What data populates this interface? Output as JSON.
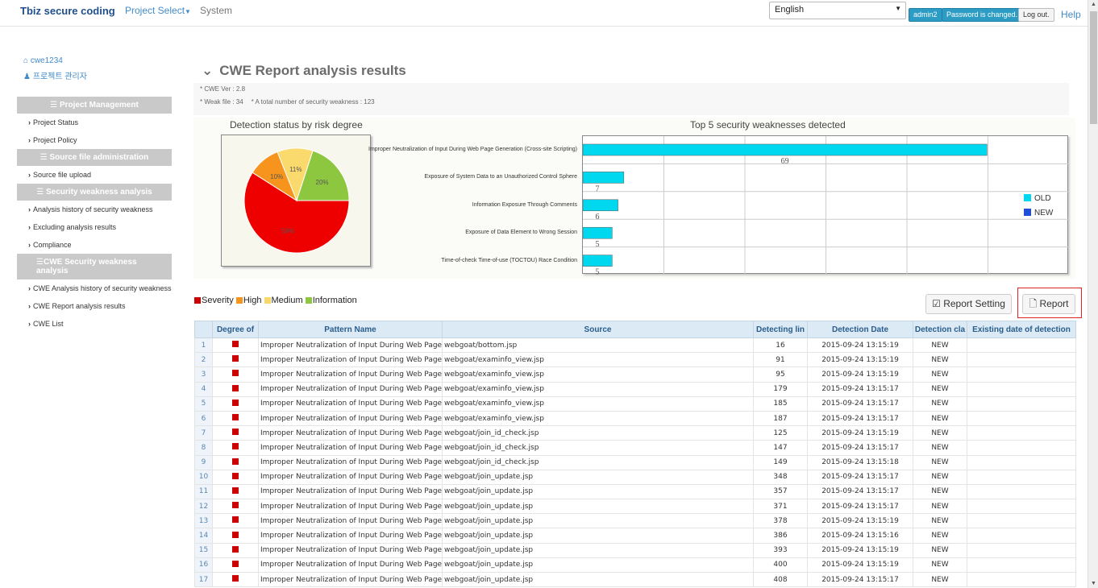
{
  "header": {
    "brand": "Tbiz secure coding",
    "project_select": "Project Select",
    "system": "System",
    "language": "English",
    "user_button": "admin2",
    "password_button": "Password is changed.",
    "logout_button": "Log out.",
    "help": "Help"
  },
  "sidebar": {
    "project_name": "cwe1234",
    "role": "프로젝트 관리자",
    "sections": [
      {
        "title": "Project Management",
        "items": [
          "Project Status",
          "Project Policy"
        ]
      },
      {
        "title": "Source file administration",
        "items": [
          "Source file upload"
        ]
      },
      {
        "title": "Security weakness analysis",
        "items": [
          "Analysis history of security weakness",
          "Excluding analysis results",
          "Compliance"
        ]
      },
      {
        "title": "CWE Security weakness analysis",
        "items": [
          "CWE Analysis history of security weakness",
          "CWE Report analysis results",
          "CWE List"
        ]
      }
    ]
  },
  "main": {
    "title": "CWE Report analysis results",
    "cwe_ver": "* CWE Ver : 2.8",
    "weak_file": "* Weak file : 34",
    "total": "* A total number of security weakness : 123",
    "legend": [
      "Severity",
      "High",
      "Medium",
      "Information"
    ],
    "legend_colors": [
      "#cc0000",
      "#f7941d",
      "#f9d86b",
      "#8dc63f"
    ],
    "report_setting": "Report Setting",
    "report": "Report"
  },
  "chart_data": [
    {
      "type": "pie",
      "title": "Detection status by risk degree",
      "labels": [
        "Severity",
        "High",
        "Medium",
        "Information"
      ],
      "values": [
        59,
        10,
        11,
        20
      ],
      "colors": [
        "#ee0000",
        "#f7941d",
        "#fad96d",
        "#8dc63f"
      ]
    },
    {
      "type": "bar",
      "title": "Top 5 security weaknesses detected",
      "categories": [
        "Improper Neutralization of Input During Web Page Generation (Cross-site Scripting)",
        "Exposure of System Data to an Unauthorized Control Sphere",
        "Information Exposure Through Comments",
        "Exposure of Data Element to Wrong Session",
        "Time-of-check Time-of-use (TOCTOU) Race Condition"
      ],
      "series": [
        {
          "name": "OLD",
          "values": [
            69,
            7,
            6,
            5,
            5
          ],
          "color": "#00d8f0"
        },
        {
          "name": "NEW",
          "values": [
            0,
            0,
            0,
            0,
            0
          ],
          "color": "#1f4fd8"
        }
      ],
      "xlim": [
        0,
        83
      ],
      "legend": "right"
    }
  ],
  "table": {
    "headers": [
      "",
      "Degree of",
      "Pattern Name",
      "Source",
      "Detecting lin",
      "Detection Date",
      "Detection cla",
      "Existing date of detection"
    ],
    "pattern": "Improper Neutralization of Input During Web Page Generation (Cross-site Scripting)",
    "rows": [
      {
        "n": "1",
        "src": "webgoat/bottom.jsp",
        "line": "16",
        "date": "2015-09-24 13:15:19",
        "cls": "NEW"
      },
      {
        "n": "2",
        "src": "webgoat/examinfo_view.jsp",
        "line": "91",
        "date": "2015-09-24 13:15:19",
        "cls": "NEW"
      },
      {
        "n": "3",
        "src": "webgoat/examinfo_view.jsp",
        "line": "95",
        "date": "2015-09-24 13:15:19",
        "cls": "NEW"
      },
      {
        "n": "4",
        "src": "webgoat/examinfo_view.jsp",
        "line": "179",
        "date": "2015-09-24 13:15:17",
        "cls": "NEW"
      },
      {
        "n": "5",
        "src": "webgoat/examinfo_view.jsp",
        "line": "185",
        "date": "2015-09-24 13:15:17",
        "cls": "NEW"
      },
      {
        "n": "6",
        "src": "webgoat/examinfo_view.jsp",
        "line": "187",
        "date": "2015-09-24 13:15:17",
        "cls": "NEW"
      },
      {
        "n": "7",
        "src": "webgoat/join_id_check.jsp",
        "line": "125",
        "date": "2015-09-24 13:15:19",
        "cls": "NEW"
      },
      {
        "n": "8",
        "src": "webgoat/join_id_check.jsp",
        "line": "147",
        "date": "2015-09-24 13:15:17",
        "cls": "NEW"
      },
      {
        "n": "9",
        "src": "webgoat/join_id_check.jsp",
        "line": "149",
        "date": "2015-09-24 13:15:18",
        "cls": "NEW"
      },
      {
        "n": "10",
        "src": "webgoat/join_update.jsp",
        "line": "348",
        "date": "2015-09-24 13:15:17",
        "cls": "NEW"
      },
      {
        "n": "11",
        "src": "webgoat/join_update.jsp",
        "line": "357",
        "date": "2015-09-24 13:15:17",
        "cls": "NEW"
      },
      {
        "n": "12",
        "src": "webgoat/join_update.jsp",
        "line": "371",
        "date": "2015-09-24 13:15:17",
        "cls": "NEW"
      },
      {
        "n": "13",
        "src": "webgoat/join_update.jsp",
        "line": "378",
        "date": "2015-09-24 13:15:19",
        "cls": "NEW"
      },
      {
        "n": "14",
        "src": "webgoat/join_update.jsp",
        "line": "386",
        "date": "2015-09-24 13:15:16",
        "cls": "NEW"
      },
      {
        "n": "15",
        "src": "webgoat/join_update.jsp",
        "line": "393",
        "date": "2015-09-24 13:15:19",
        "cls": "NEW"
      },
      {
        "n": "16",
        "src": "webgoat/join_update.jsp",
        "line": "400",
        "date": "2015-09-24 13:15:19",
        "cls": "NEW"
      },
      {
        "n": "17",
        "src": "webgoat/join_update.jsp",
        "line": "408",
        "date": "2015-09-24 13:15:17",
        "cls": "NEW"
      }
    ]
  }
}
